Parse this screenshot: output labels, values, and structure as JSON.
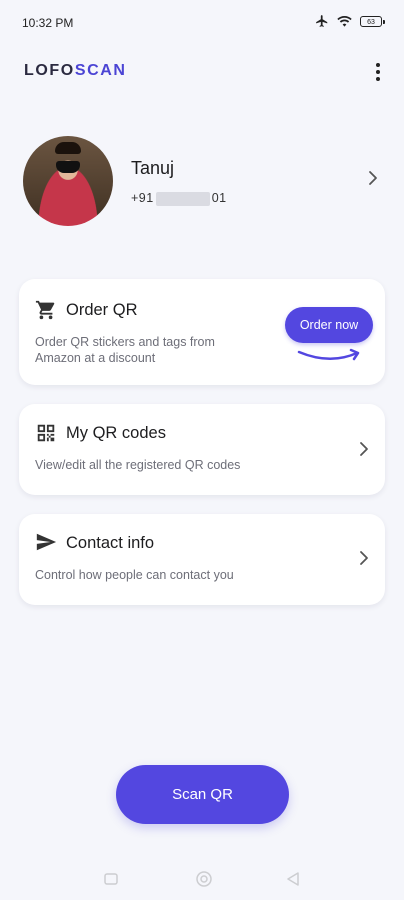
{
  "status_bar": {
    "time": "10:32 PM",
    "battery": "63"
  },
  "app": {
    "logo_part1": "LOFO",
    "logo_part2": "SCAN"
  },
  "profile": {
    "name": "Tanuj",
    "phone_prefix": "+91",
    "phone_suffix": "01"
  },
  "cards": {
    "order": {
      "title": "Order QR",
      "description": "Order QR stickers and tags from Amazon at a discount",
      "button": "Order now"
    },
    "my_codes": {
      "title": "My QR codes",
      "description": "View/edit all the registered QR codes"
    },
    "contact": {
      "title": "Contact info",
      "description": "Control how people can contact you"
    }
  },
  "scan_button": "Scan QR",
  "icons": [
    "airplane-icon",
    "wifi-icon",
    "battery-icon",
    "more-vert-icon",
    "chevron-right-icon",
    "cart-icon",
    "amazon-smile-icon",
    "qr-code-icon",
    "send-icon",
    "nav-recent-icon",
    "nav-home-icon",
    "nav-back-icon"
  ],
  "colors": {
    "accent": "#5347e0",
    "background": "#f5f6fb",
    "logo_dark": "#2b2a40"
  }
}
